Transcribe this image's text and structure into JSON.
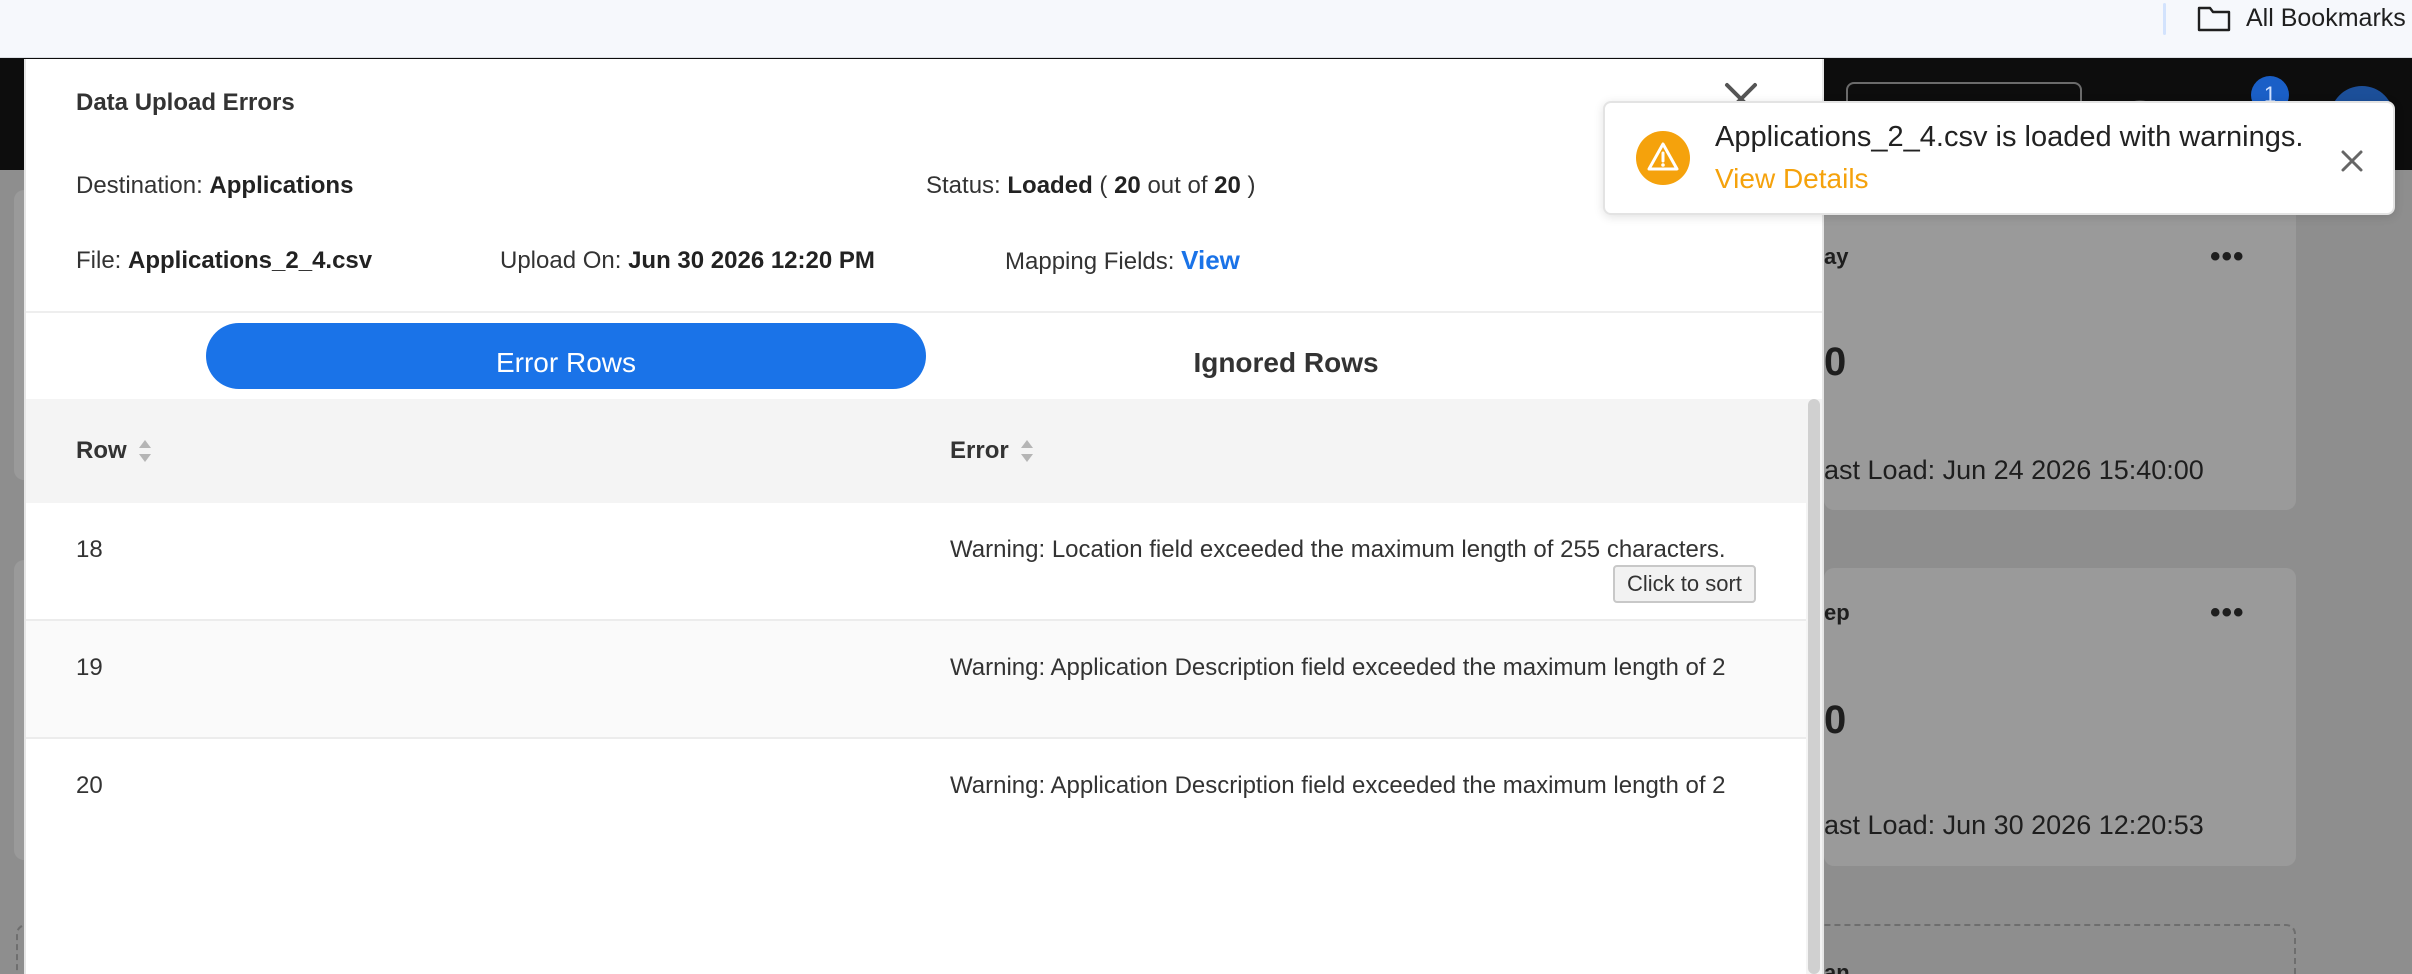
{
  "browser": {
    "bookmarks_label": "All Bookmarks"
  },
  "background": {
    "topbar_badge": "1",
    "cards": [
      {
        "title_fragment": "ay",
        "value_fragment": "0",
        "last_load": "ast Load: Jun 24 2026 15:40:00"
      },
      {
        "title_fragment": "ep",
        "value_fragment": "0",
        "last_load": "ast Load: Jun 30 2026 12:20:53"
      }
    ],
    "dashed_card_fragment": "an"
  },
  "modal": {
    "title": "Data Upload Errors",
    "destination_label": "Destination:",
    "destination_value": "Applications",
    "status_label": "Status:",
    "status_value": "Loaded",
    "status_open": "(",
    "status_loaded_count": "20",
    "status_out_of": "out of",
    "status_total": "20",
    "status_close": ")",
    "file_label": "File:",
    "file_value": "Applications_2_4.csv",
    "upload_label": "Upload On:",
    "upload_value": "Jun 30 2026 12:20 PM",
    "mapping_label": "Mapping Fields:",
    "mapping_link": "View",
    "tabs": {
      "error_rows": "Error Rows",
      "ignored_rows": "Ignored Rows",
      "active": "error_rows"
    },
    "table": {
      "columns": [
        "Row",
        "Error"
      ],
      "rows": [
        {
          "row": "18",
          "error": "Warning: Location field exceeded the maximum length of 255 characters."
        },
        {
          "row": "19",
          "error": "Warning: Application Description field exceeded the maximum length of 2"
        },
        {
          "row": "20",
          "error": "Warning: Application Description field exceeded the maximum length of 2"
        }
      ]
    },
    "tooltip": "Click to sort"
  },
  "toast": {
    "message": "Applications_2_4.csv is loaded with warnings.",
    "link": "View Details",
    "warning_color": "#f5a20c"
  },
  "colors": {
    "accent": "#1a73e8",
    "warning": "#f5a20c"
  },
  "icons": [
    "folder-icon",
    "close-icon",
    "sort-icon",
    "warning-icon",
    "more-icon"
  ]
}
